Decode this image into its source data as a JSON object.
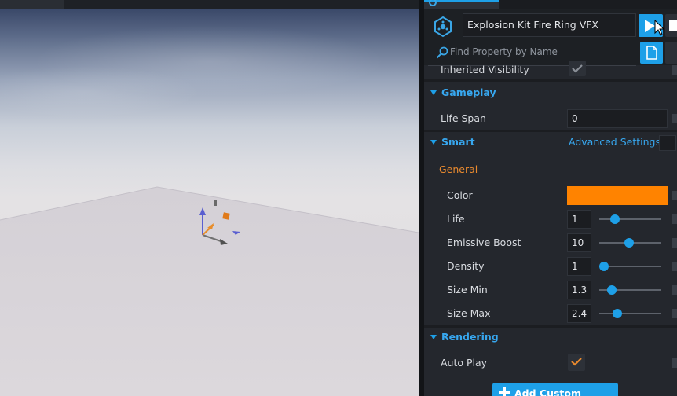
{
  "object_name": "Explosion Kit Fire Ring VFX",
  "search": {
    "placeholder": "Find Property by Name"
  },
  "properties": {
    "inherited_visibility": {
      "label": "Inherited Visibility",
      "checked": true
    },
    "gameplay": {
      "title": "Gameplay",
      "life_span": {
        "label": "Life Span",
        "value": "0"
      }
    },
    "smart": {
      "title": "Smart",
      "advanced_link": "Advanced Settings",
      "general_label": "General",
      "color": {
        "label": "Color",
        "value": "#ff8300"
      },
      "sliders": [
        {
          "label": "Life",
          "value": "1",
          "fraction": 0.26
        },
        {
          "label": "Emissive Boost",
          "value": "10",
          "fraction": 0.49
        },
        {
          "label": "Density",
          "value": "1",
          "fraction": 0.08
        },
        {
          "label": "Size Min",
          "value": "1.3",
          "fraction": 0.2
        },
        {
          "label": "Size Max",
          "value": "2.4",
          "fraction": 0.29
        }
      ]
    },
    "rendering": {
      "title": "Rendering",
      "auto_play": {
        "label": "Auto Play",
        "checked": true
      }
    }
  },
  "add_custom_property": "Add Custom Property",
  "colors": {
    "accent": "#1ea0e8",
    "section_title": "#37a7ef",
    "general_heading": "#e8892e",
    "swatch": "#ff8300"
  },
  "icons": [
    "vfx-object-icon",
    "play-icon",
    "stop-icon",
    "search-icon",
    "document-icon",
    "checkmark-icon",
    "plus-icon",
    "cursor-icon"
  ]
}
